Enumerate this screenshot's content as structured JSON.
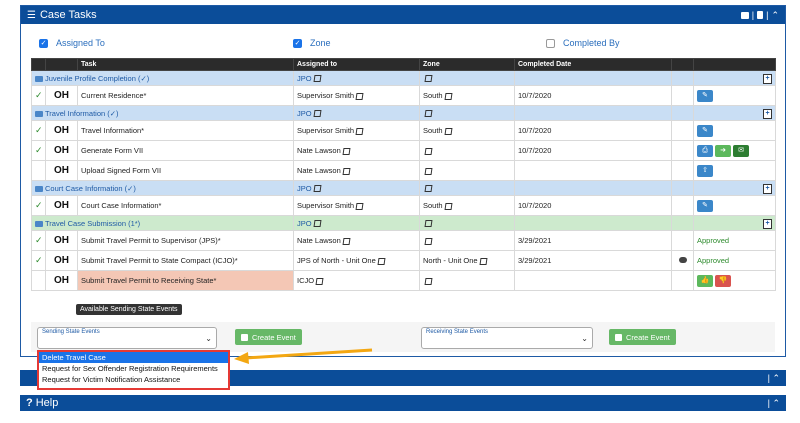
{
  "panel": {
    "title": "Case Tasks",
    "header_icons": [
      "envelope-icon",
      "document-icon",
      "chevron-up-icon"
    ]
  },
  "filters": [
    {
      "label": "Assigned To",
      "checked": true
    },
    {
      "label": "Zone",
      "checked": true
    },
    {
      "label": "Completed By",
      "checked": false
    }
  ],
  "table": {
    "columns": [
      "",
      "",
      "Task",
      "Assigned to",
      "Zone",
      "Completed Date",
      "",
      ""
    ],
    "groups": [
      {
        "name": "Juvenile Profile Completion (✓)",
        "assigned": "JPO",
        "rows": [
          {
            "check": "✓",
            "state": "OH",
            "task": "Current Residence*",
            "assigned": "Supervisor Smith",
            "zone": "South",
            "date": "10/7/2020",
            "status": ""
          }
        ]
      },
      {
        "name": "Travel Information (✓)",
        "assigned": "JPO",
        "rows": [
          {
            "check": "✓",
            "state": "OH",
            "task": "Travel Information*",
            "assigned": "Supervisor Smith",
            "zone": "South",
            "date": "10/7/2020",
            "status": ""
          },
          {
            "check": "✓",
            "state": "OH",
            "task": "Generate Form VII",
            "assigned": "Nate Lawson",
            "zone": "",
            "date": "10/7/2020",
            "status": ""
          },
          {
            "check": "",
            "state": "OH",
            "task": "Upload Signed Form VII",
            "assigned": "Nate Lawson",
            "zone": "",
            "date": "",
            "status": ""
          }
        ]
      },
      {
        "name": "Court Case Information (✓)",
        "assigned": "JPO",
        "rows": [
          {
            "check": "✓",
            "state": "OH",
            "task": "Court Case Information*",
            "assigned": "Supervisor Smith",
            "zone": "South",
            "date": "10/7/2020",
            "status": ""
          }
        ]
      },
      {
        "name": "Travel Case Submission (1*)",
        "assigned": "JPO",
        "rows": [
          {
            "check": "✓",
            "state": "OH",
            "task": "Submit Travel Permit to Supervisor (JPS)*",
            "assigned": "Nate Lawson",
            "zone": "",
            "date": "3/29/2021",
            "status": "Approved"
          },
          {
            "check": "✓",
            "state": "OH",
            "task": "Submit Travel Permit to State Compact (ICJO)*",
            "assigned": "JPS of North - Unit One",
            "zone": "North - Unit One",
            "date": "3/29/2021",
            "status": "Approved"
          },
          {
            "check": "",
            "state": "OH",
            "task": "Submit Travel Permit to Receiving State*",
            "assigned": "ICJO",
            "zone": "",
            "date": "",
            "status": ""
          }
        ]
      }
    ]
  },
  "events": {
    "tooltip": "Available Sending State Events",
    "sending_label": "Sending State Events",
    "receiving_label": "Receiving State Events",
    "create_label": "Create Event"
  },
  "dropdown_options": [
    "Delete Travel Case",
    "Request for Sex Offender Registration Requirements",
    "Request for Victim Notification Assistance"
  ],
  "collapsed_panels": [
    {
      "title": ""
    },
    {
      "title": "Help"
    }
  ],
  "colors": {
    "header": "#0b4d99",
    "group_blue": "#c9def4",
    "group_green": "#cdeacd",
    "highlight": "#f4c7b5",
    "callout_border": "#e53935",
    "arrow": "#f3a712"
  }
}
